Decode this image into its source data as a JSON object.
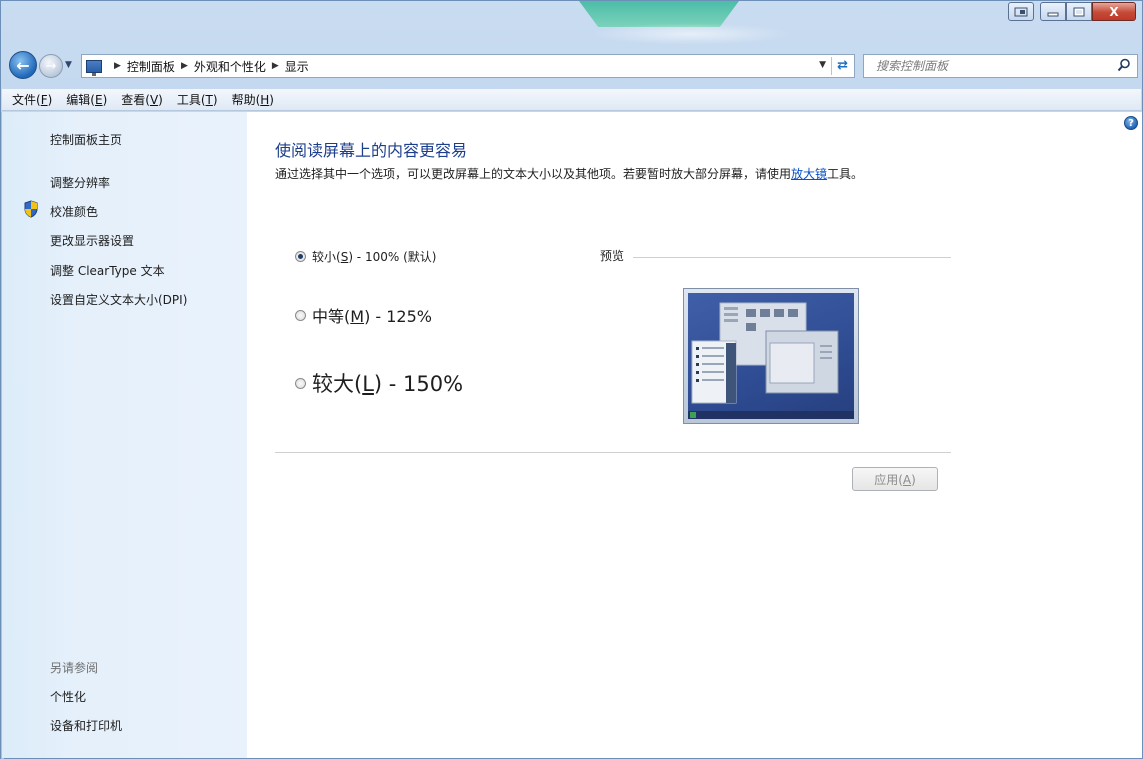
{
  "window": {
    "caption_buttons": [
      "restore-small",
      "minimize",
      "maximize",
      "close"
    ],
    "close_glyph": "X"
  },
  "nav": {
    "breadcrumb": [
      "控制面板",
      "外观和个性化",
      "显示"
    ],
    "search_placeholder": "搜索控制面板"
  },
  "menu": [
    {
      "label": "文件(",
      "key": "F",
      "suffix": ")"
    },
    {
      "label": "编辑(",
      "key": "E",
      "suffix": ")"
    },
    {
      "label": "查看(",
      "key": "V",
      "suffix": ")"
    },
    {
      "label": "工具(",
      "key": "T",
      "suffix": ")"
    },
    {
      "label": "帮助(",
      "key": "H",
      "suffix": ")"
    }
  ],
  "sidebar": {
    "home": "控制面板主页",
    "items": [
      "调整分辨率",
      "校准颜色",
      "更改显示器设置",
      "调整 ClearType 文本",
      "设置自定义文本大小(DPI)"
    ],
    "see_also_label": "另请参阅",
    "see_also": [
      "个性化",
      "设备和打印机"
    ]
  },
  "main": {
    "title": "使阅读屏幕上的内容更容易",
    "description_before": "通过选择其中一个选项，可以更改屏幕上的文本大小以及其他项。若要暂时放大部分屏幕，请使用",
    "description_link": "放大镜",
    "description_after": "工具。",
    "options": [
      {
        "pre": "较小(",
        "key": "S",
        "post": ") - 100% (默认)",
        "selected": true
      },
      {
        "pre": "中等(",
        "key": "M",
        "post": ") - 125%",
        "selected": false
      },
      {
        "pre": "较大(",
        "key": "L",
        "post": ") - 150%",
        "selected": false
      }
    ],
    "preview_label": "预览",
    "apply_pre": "应用(",
    "apply_key": "A",
    "apply_post": ")",
    "help_glyph": "?"
  },
  "colors": {
    "title_blue": "#1c3e8c",
    "link_blue": "#0a4fc6",
    "close_red": "#c54a37"
  }
}
